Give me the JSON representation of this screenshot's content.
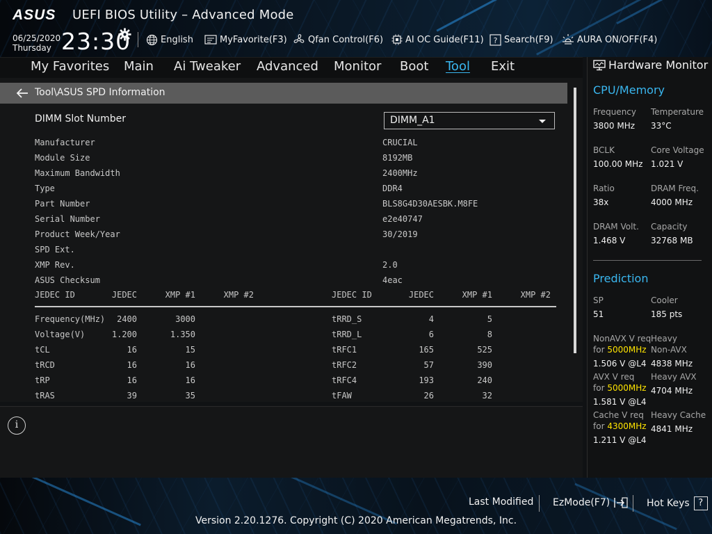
{
  "header": {
    "title": "UEFI BIOS Utility – Advanced Mode",
    "logo_text": "ASUS",
    "date": "06/25/2020",
    "day": "Thursday",
    "time": "23:30",
    "items": [
      {
        "label": "English",
        "icon": "globe-icon"
      },
      {
        "label": "MyFavorite(F3)",
        "icon": "favorite-icon"
      },
      {
        "label": "Qfan Control(F6)",
        "icon": "fan-icon"
      },
      {
        "label": "AI OC Guide(F11)",
        "icon": "ai-oc-icon"
      },
      {
        "label": "Search(F9)",
        "icon": "search-help-icon"
      },
      {
        "label": "AURA ON/OFF(F4)",
        "icon": "aura-icon"
      }
    ]
  },
  "menu": {
    "tabs": [
      {
        "label": "My Favorites"
      },
      {
        "label": "Main"
      },
      {
        "label": "Ai Tweaker"
      },
      {
        "label": "Advanced"
      },
      {
        "label": "Monitor"
      },
      {
        "label": "Boot"
      },
      {
        "label": "Tool"
      },
      {
        "label": "Exit"
      }
    ],
    "active": "Tool"
  },
  "main": {
    "breadcrumb": "Tool\\ASUS SPD Information",
    "dimm_slot": {
      "label": "DIMM Slot Number",
      "value": "DIMM_A1"
    },
    "info": [
      {
        "label": "Manufacturer",
        "value": "CRUCIAL"
      },
      {
        "label": "Module Size",
        "value": "8192MB"
      },
      {
        "label": "Maximum Bandwidth",
        "value": "2400MHz"
      },
      {
        "label": "Type",
        "value": "DDR4"
      },
      {
        "label": "Part Number",
        "value": "BLS8G4D30AESBK.M8FE"
      },
      {
        "label": "Serial Number",
        "value": "e2e40747"
      },
      {
        "label": "Product Week/Year",
        "value": "30/2019"
      },
      {
        "label": "SPD Ext.",
        "value": ""
      },
      {
        "label": "XMP Rev.",
        "value": "2.0"
      },
      {
        "label": "ASUS Checksum",
        "value": "4eac"
      }
    ],
    "table_headers": {
      "left": [
        "JEDEC ID",
        "JEDEC",
        "XMP #1",
        "XMP #2"
      ],
      "right": [
        "JEDEC ID",
        "JEDEC",
        "XMP #1",
        "XMP #2"
      ]
    },
    "table_left": [
      [
        "Frequency(MHz)",
        "2400",
        "3000",
        ""
      ],
      [
        "Voltage(V)",
        "1.200",
        "1.350",
        ""
      ],
      [
        "tCL",
        "16",
        "15",
        ""
      ],
      [
        "tRCD",
        "16",
        "16",
        ""
      ],
      [
        "tRP",
        "16",
        "16",
        ""
      ],
      [
        "tRAS",
        "39",
        "35",
        ""
      ]
    ],
    "table_right": [
      [
        "tRRD_S",
        "4",
        "5",
        ""
      ],
      [
        "tRRD_L",
        "6",
        "8",
        ""
      ],
      [
        "tRFC1",
        "165",
        "525",
        ""
      ],
      [
        "tRFC2",
        "57",
        "390",
        ""
      ],
      [
        "tRFC4",
        "193",
        "240",
        ""
      ],
      [
        "tFAW",
        "26",
        "32",
        ""
      ]
    ]
  },
  "hardware_monitor": {
    "title": "Hardware Monitor",
    "cpu_memory": {
      "title": "CPU/Memory",
      "items": [
        {
          "label": "Frequency",
          "value": "3800 MHz"
        },
        {
          "label": "Temperature",
          "value": "33°C"
        },
        {
          "label": "BCLK",
          "value": "100.00 MHz"
        },
        {
          "label": "Core Voltage",
          "value": "1.021 V"
        },
        {
          "label": "Ratio",
          "value": "38x"
        },
        {
          "label": "DRAM Freq.",
          "value": "4000 MHz"
        },
        {
          "label": "DRAM Volt.",
          "value": "1.468 V"
        },
        {
          "label": "Capacity",
          "value": "32768 MB"
        }
      ]
    },
    "prediction": {
      "title": "Prediction",
      "sp_label": "SP",
      "sp_value": "51",
      "cooler_label": "Cooler",
      "cooler_value": "185 pts",
      "nonavx_label": "NonAVX V req",
      "nonavx_for": "for",
      "nonavx_freq": "5000MHz",
      "nonavx_value": "1.506 V @L4",
      "heavy_nonavx_label1": "Heavy",
      "heavy_nonavx_label2": "Non-AVX",
      "heavy_nonavx_value": "4838 MHz",
      "avx_label": "AVX V req",
      "avx_for": "for",
      "avx_freq": "5000MHz",
      "avx_value": "1.581 V @L4",
      "heavy_avx_label": "Heavy AVX",
      "heavy_avx_value": "4704 MHz",
      "cache_label": "Cache V req",
      "cache_for": "for",
      "cache_freq": "4300MHz",
      "cache_value": "1.211 V @L4",
      "heavy_cache_label": "Heavy Cache",
      "heavy_cache_value": "4841 MHz"
    }
  },
  "footer": {
    "last_modified": "Last Modified",
    "ezmode": "EzMode(F7)",
    "hotkeys": "Hot Keys",
    "hotkeys_symbol": "?",
    "copyright": "Version 2.20.1276. Copyright (C) 2020 American Megatrends, Inc."
  },
  "colors": {
    "accent": "#3ab7f0",
    "highlight": "#ffe400",
    "breadcrumb_bg": "#5b5b5b"
  }
}
